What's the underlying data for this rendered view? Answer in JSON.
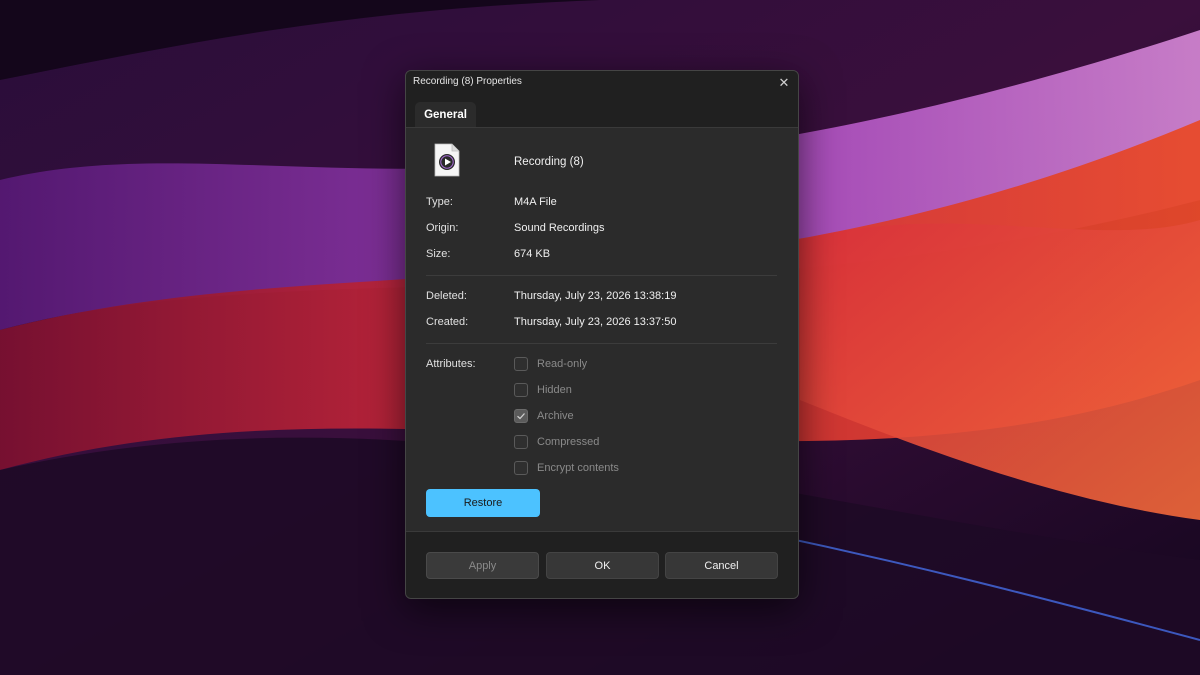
{
  "window": {
    "title": "Recording (8) Properties"
  },
  "tabs": [
    {
      "label": "General"
    }
  ],
  "file": {
    "name": "Recording (8)",
    "icon": "media-file-icon"
  },
  "properties": [
    {
      "label": "Type:",
      "value": "M4A File"
    },
    {
      "label": "Origin:",
      "value": "Sound Recordings"
    },
    {
      "label": "Size:",
      "value": "674 KB"
    }
  ],
  "dates": [
    {
      "label": "Deleted:",
      "value": "Thursday, July 23, 2026 13:38:19"
    },
    {
      "label": "Created:",
      "value": "Thursday, July 23, 2026 13:37:50"
    }
  ],
  "attributes": {
    "label": "Attributes:",
    "items": [
      {
        "label": "Read-only",
        "checked": false
      },
      {
        "label": "Hidden",
        "checked": false
      },
      {
        "label": "Archive",
        "checked": true
      },
      {
        "label": "Compressed",
        "checked": false
      },
      {
        "label": "Encrypt contents",
        "checked": false
      }
    ]
  },
  "buttons": {
    "restore": "Restore",
    "apply": "Apply",
    "ok": "OK",
    "cancel": "Cancel"
  },
  "colors": {
    "accent": "#4cc2ff",
    "dialog_bg": "#2b2b2b",
    "titlebar_bg": "#202020"
  }
}
